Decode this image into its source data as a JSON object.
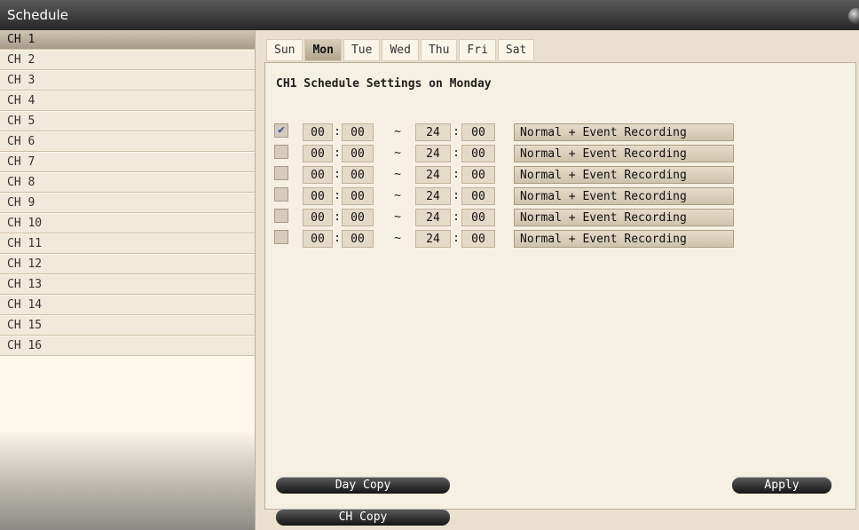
{
  "window": {
    "title": "Schedule"
  },
  "channels": [
    "CH 1",
    "CH 2",
    "CH 3",
    "CH 4",
    "CH 5",
    "CH 6",
    "CH 7",
    "CH 8",
    "CH 9",
    "CH 10",
    "CH 11",
    "CH 12",
    "CH 13",
    "CH 14",
    "CH 15",
    "CH 16"
  ],
  "selected_channel": "CH 1",
  "days": [
    "Sun",
    "Mon",
    "Tue",
    "Wed",
    "Thu",
    "Fri",
    "Sat"
  ],
  "selected_day": "Mon",
  "heading": "CH1 Schedule Settings on Monday",
  "separators": {
    "colon": ":",
    "tilde": "~"
  },
  "schedule_rows": [
    {
      "checked": true,
      "start_h": "00",
      "start_m": "00",
      "end_h": "24",
      "end_m": "00",
      "mode": "Normal + Event Recording"
    },
    {
      "checked": false,
      "start_h": "00",
      "start_m": "00",
      "end_h": "24",
      "end_m": "00",
      "mode": "Normal + Event Recording"
    },
    {
      "checked": false,
      "start_h": "00",
      "start_m": "00",
      "end_h": "24",
      "end_m": "00",
      "mode": "Normal + Event Recording"
    },
    {
      "checked": false,
      "start_h": "00",
      "start_m": "00",
      "end_h": "24",
      "end_m": "00",
      "mode": "Normal + Event Recording"
    },
    {
      "checked": false,
      "start_h": "00",
      "start_m": "00",
      "end_h": "24",
      "end_m": "00",
      "mode": "Normal + Event Recording"
    },
    {
      "checked": false,
      "start_h": "00",
      "start_m": "00",
      "end_h": "24",
      "end_m": "00",
      "mode": "Normal + Event Recording"
    }
  ],
  "buttons": {
    "day_copy": "Day Copy",
    "apply": "Apply",
    "ch_copy": "CH Copy"
  },
  "colors": {
    "accent_check": "#2b4fb5",
    "titlebar": "#3a3a3a",
    "background": "#f6f0e2"
  }
}
